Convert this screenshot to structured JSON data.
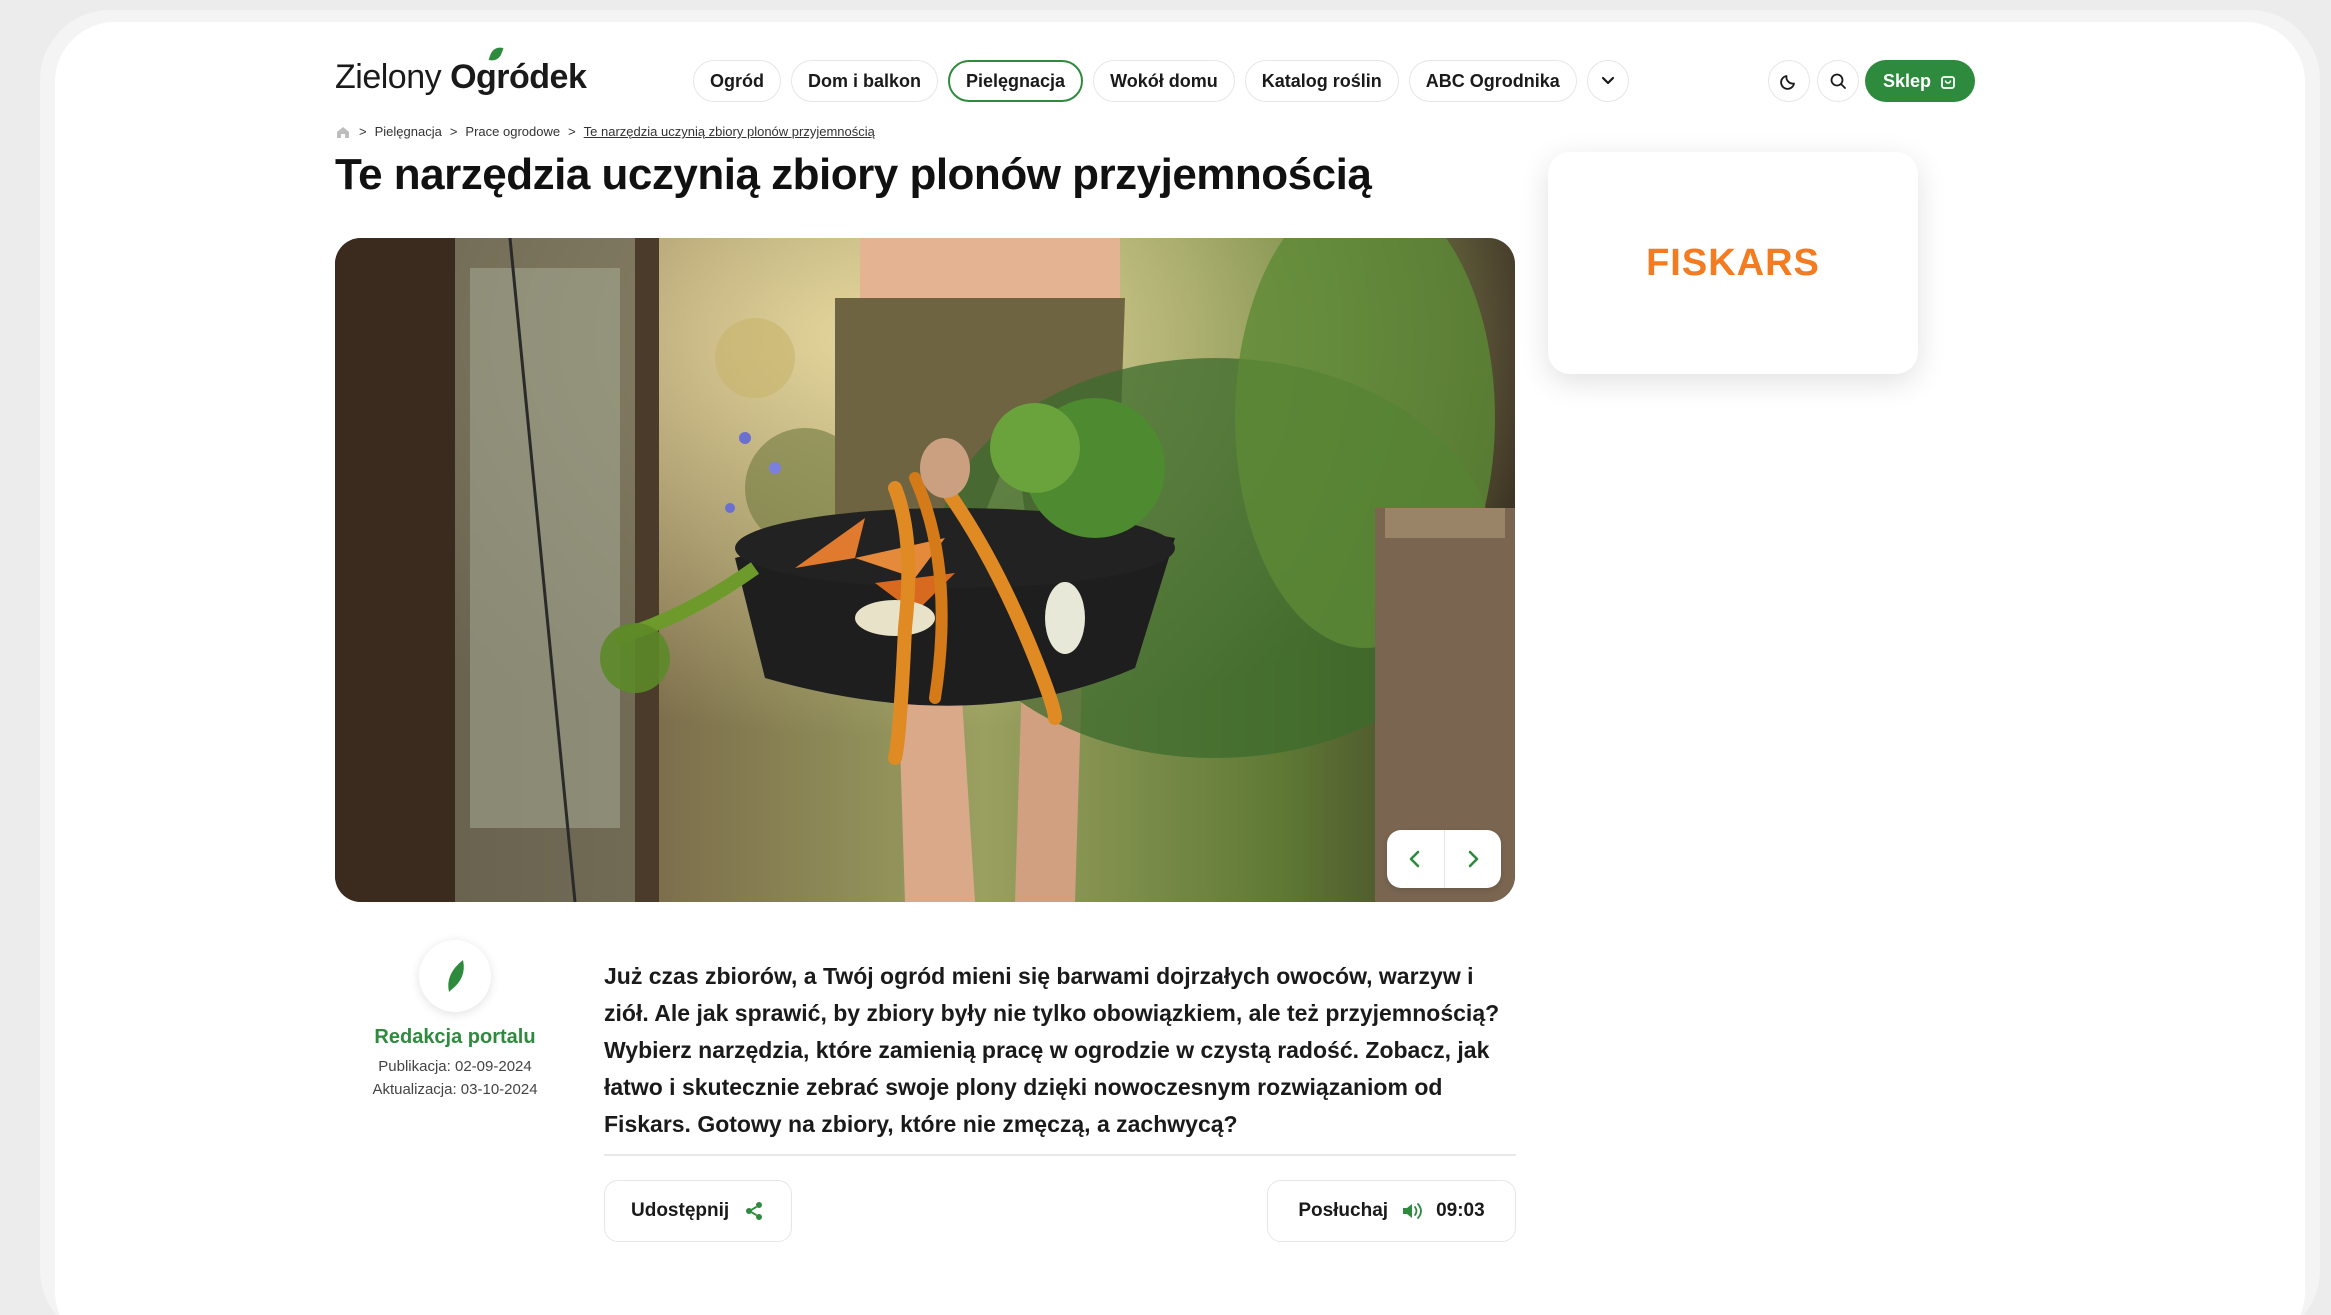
{
  "logo": {
    "part1": "Zielony ",
    "part2": "Ogródek"
  },
  "nav": {
    "items": [
      {
        "label": "Ogród"
      },
      {
        "label": "Dom i balkon"
      },
      {
        "label": "Pielęgnacja"
      },
      {
        "label": "Wokół domu"
      },
      {
        "label": "Katalog roślin"
      },
      {
        "label": "ABC Ogrodnika"
      }
    ],
    "active_index": 2
  },
  "header": {
    "shop_label": "Sklep"
  },
  "breadcrumb": {
    "items": [
      "Pielęgnacja",
      "Prace ogrodowe"
    ],
    "current": "Te narzędzia uczynią zbiory plonów przyjemnością"
  },
  "article": {
    "title": "Te narzędzia uczynią zbiory plonów przyjemnością",
    "lead": "Już czas zbiorów, a Twój ogród mieni się barwami dojrzałych owoców, warzyw i ziół. Ale jak sprawić, by zbiory były nie tylko obowiązkiem, ale też przyjemnością? Wybierz narzędzia, które zamienią pracę w ogrodzie w czystą radość. Zobacz, jak łatwo i skutecznie zebrać swoje plony dzięki nowoczesnym rozwiązaniom od Fiskars. Gotowy na zbiory, które nie zmęczą, a zachwycą?"
  },
  "author": {
    "name": "Redakcja portalu",
    "published": "Publikacja: 02-09-2024",
    "updated": "Aktualizacja: 03-10-2024"
  },
  "ad": {
    "brand": "FISKARS"
  },
  "actions": {
    "share_label": "Udostępnij",
    "listen_label": "Posłuchaj",
    "duration": "09:03"
  },
  "colors": {
    "accent": "#2e8b3e",
    "brand_orange": "#f47b20"
  }
}
